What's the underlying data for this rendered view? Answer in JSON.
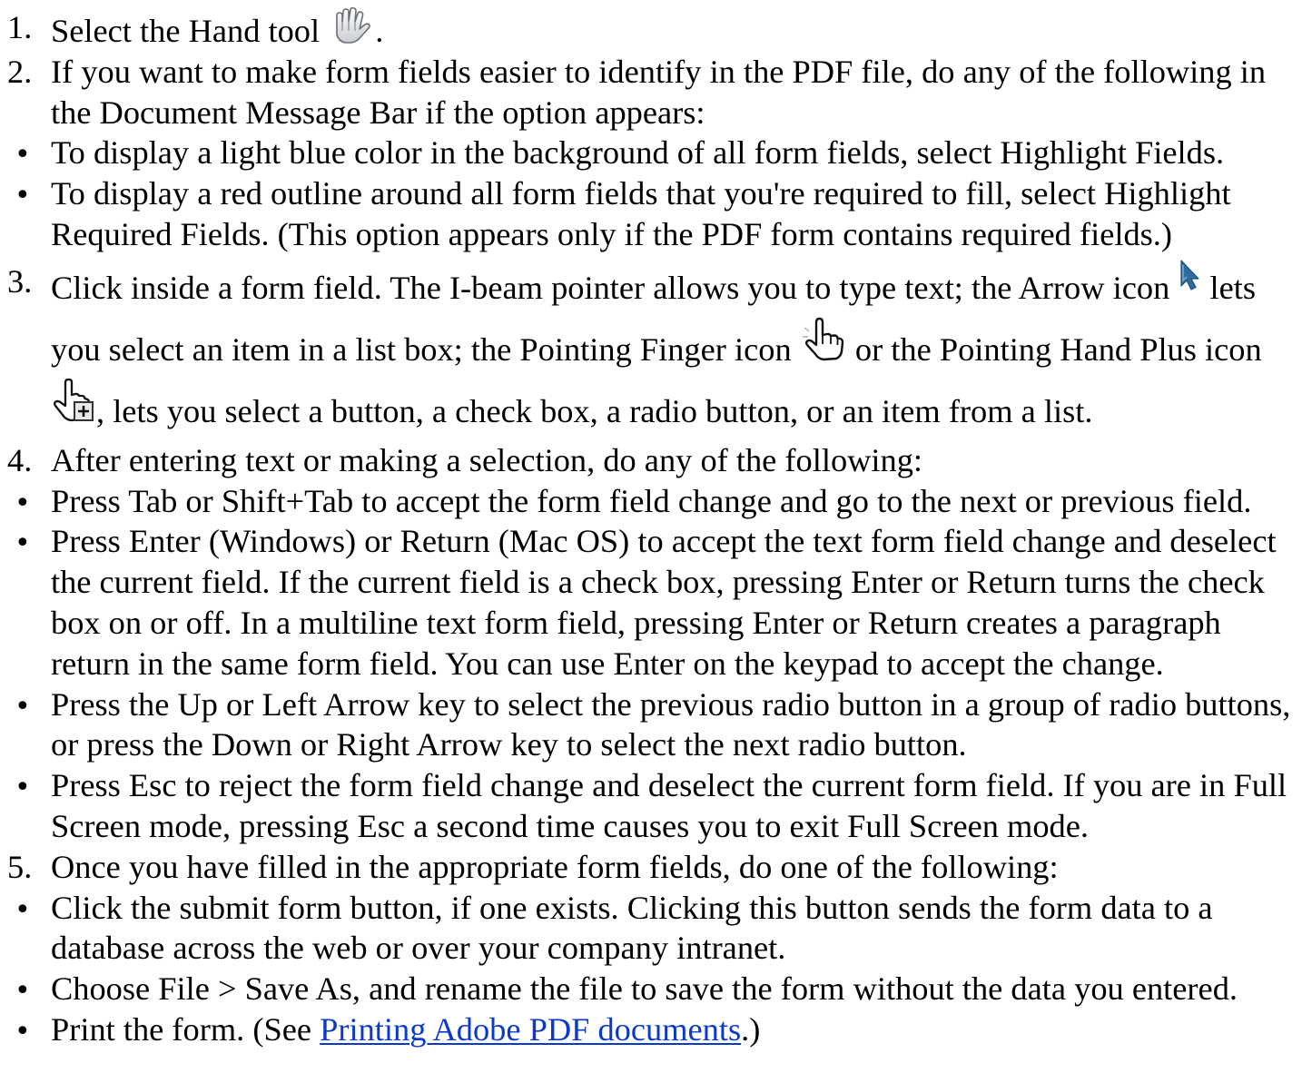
{
  "steps": [
    {
      "num": "1.",
      "text": "Select the Hand tool",
      "after_icon": "."
    },
    {
      "num": "2.",
      "text": "If you want to make form fields easier to identify in the PDF file, do any of the following in the Document Message Bar if the option appears:",
      "bullets": [
        "To display a light blue color in the background of all form fields, select Highlight Fields.",
        "To display a red outline around all form fields that you're required to fill, select Highlight Required Fields. (This option appears only if the PDF form contains required fields.)"
      ]
    },
    {
      "num": "3.",
      "text_a": "Click inside a form field. The I-beam pointer allows you to type text; the Arrow icon",
      "text_b": "lets you select an item in a list box; the Pointing Finger icon",
      "text_c": "or the Pointing Hand Plus icon",
      "text_d": ", lets you select a button, a check box, a radio button, or an item from a list."
    },
    {
      "num": "4.",
      "text": "After entering text or making a selection, do any of the following:",
      "bullets": [
        "Press Tab or Shift+Tab to accept the form field change and go to the next or previous field.",
        "Press Enter (Windows) or Return (Mac OS) to accept the text form field change and deselect the current field. If the current field is a check box, pressing Enter or Return turns the check box on or off. In a multiline text form field, pressing Enter or Return creates a paragraph return in the same form field. You can use Enter on the keypad to accept the change.",
        "Press the Up or Left Arrow key to select the previous radio button in a group of radio buttons, or press the Down or Right Arrow key to select the next radio button.",
        "Press Esc to reject the form field change and deselect the current form field. If you are in Full Screen mode, pressing Esc a second time causes you to exit Full Screen mode."
      ]
    },
    {
      "num": "5.",
      "text": "Once you have filled in the appropriate form fields, do one of the following:",
      "bullets": [
        "Click the submit form button, if one exists. Clicking this button sends the form data to a database across the web or over your company intranet.",
        "Choose File > Save As, and rename the file to save the form without the data you entered."
      ],
      "last_bullet": {
        "prefix": "Print the form. (See ",
        "link": "Printing Adobe PDF documents",
        "suffix": ".)"
      }
    }
  ],
  "bullet_glyph": "•",
  "icons": {
    "hand": "hand-tool-icon",
    "arrow": "arrow-pointer-icon",
    "finger": "pointing-finger-icon",
    "hand_plus": "pointing-hand-plus-icon"
  },
  "link_color": "#0b39cc"
}
